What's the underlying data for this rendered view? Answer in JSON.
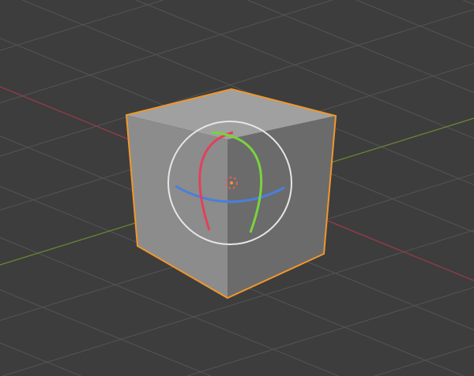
{
  "viewport": {
    "background": "#3d3d3d",
    "grid_color": "#545454",
    "x_axis_color": "#9b3a48",
    "y_axis_color": "#6a8a2f",
    "selection_outline": "#f0972e",
    "object": "cube",
    "selected": true
  },
  "gizmo": {
    "mode": "rotate",
    "trackball_color": "#e6e6e6",
    "x_color": "#e2415a",
    "y_color": "#7ad33d",
    "z_color": "#4a7fdc"
  }
}
